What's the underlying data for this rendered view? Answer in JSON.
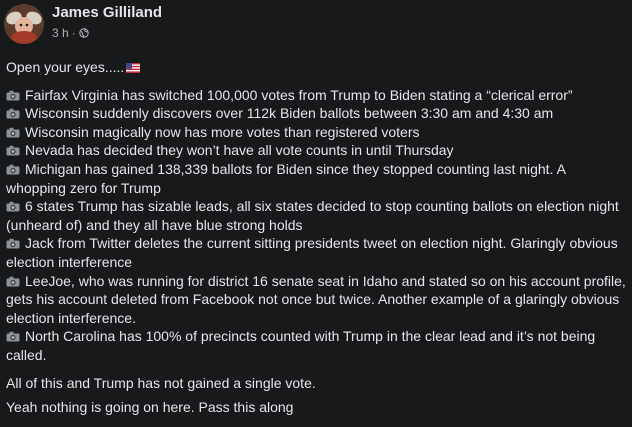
{
  "post": {
    "author": "James Gilliland",
    "time": "3 h",
    "separator": "·",
    "intro": "Open your eyes.....",
    "bullet_icon": "camera-icon",
    "flag_icon": "us-flag-icon",
    "items": [
      "Fairfax Virginia has switched 100,000 votes from Trump to Biden stating a “clerical error”",
      "Wisconsin suddenly discovers over 112k Biden ballots between 3:30 am and 4:30 am",
      "Wisconsin magically now has more votes than registered voters",
      "Nevada has decided they won’t have all vote counts in until Thursday",
      "Michigan has gained 138,339 ballots for Biden since they stopped counting last night. A whopping zero for Trump",
      "6 states Trump has sizable leads, all six states decided to stop counting ballots on election night (unheard of) and they all have blue strong holds",
      "Jack from Twitter deletes the current sitting presidents tweet on election night. Glaringly obvious election interference",
      "LeeJoe, who was running for district 16 senate seat in Idaho and stated so on his account profile, gets his account deleted from Facebook not once but twice. Another example of a glaringly obvious election interference.",
      "North Carolina has 100% of precincts counted with Trump in the clear lead and it’s not being called."
    ],
    "closing_1": "All of this and Trump has not gained a single vote.",
    "closing_2": "Yeah nothing is going on here.  Pass this along"
  },
  "colors": {
    "background": "#18191a",
    "text_primary": "#e4e6eb",
    "text_secondary": "#b0b3b8"
  }
}
